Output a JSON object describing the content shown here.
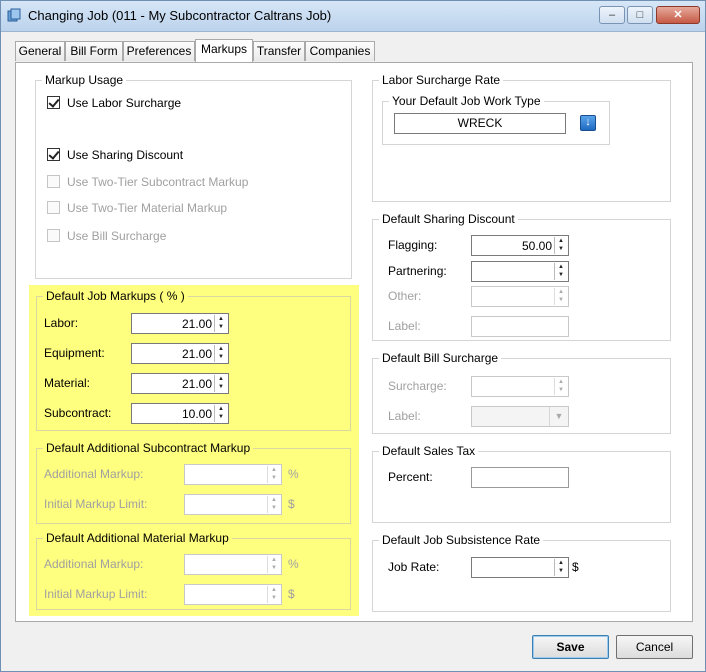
{
  "window": {
    "title": "Changing Job  (011 - My Subcontractor Caltrans Job)",
    "minimize_glyph": "–",
    "maximize_glyph": "□",
    "close_glyph": "✕"
  },
  "tabs": [
    {
      "label": "General"
    },
    {
      "label": "Bill Form"
    },
    {
      "label": "Preferences"
    },
    {
      "label": "Markups"
    },
    {
      "label": "Transfer"
    },
    {
      "label": "Companies"
    }
  ],
  "markup_usage": {
    "title": "Markup Usage",
    "use_labor_surcharge": "Use Labor Surcharge",
    "use_sharing_discount": "Use Sharing Discount",
    "use_two_tier_subcontract": "Use Two-Tier Subcontract Markup",
    "use_two_tier_material": "Use Two-Tier Material Markup",
    "use_bill_surcharge": "Use Bill Surcharge"
  },
  "default_job_markups": {
    "title": "Default Job Markups ( % )",
    "labor_label": "Labor:",
    "labor_value": "21.00",
    "equipment_label": "Equipment:",
    "equipment_value": "21.00",
    "material_label": "Material:",
    "material_value": "21.00",
    "subcontract_label": "Subcontract:",
    "subcontract_value": "10.00"
  },
  "additional_subcontract": {
    "title": "Default Additional Subcontract Markup",
    "additional_label": "Additional Markup:",
    "additional_unit": "%",
    "limit_label": "Initial Markup Limit:",
    "limit_unit": "$"
  },
  "additional_material": {
    "title": "Default Additional Material Markup",
    "additional_label": "Additional Markup:",
    "additional_unit": "%",
    "limit_label": "Initial Markup Limit:",
    "limit_unit": "$"
  },
  "labor_surcharge_rate": {
    "title": "Labor Surcharge Rate",
    "work_type_title": "Your Default Job Work Type",
    "work_type_value": "WRECK"
  },
  "sharing_discount": {
    "title": "Default Sharing Discount",
    "flagging_label": "Flagging:",
    "flagging_value": "50.00",
    "partnering_label": "Partnering:",
    "other_label": "Other:",
    "label_label": "Label:"
  },
  "bill_surcharge": {
    "title": "Default Bill Surcharge",
    "surcharge_label": "Surcharge:",
    "label_label": "Label:"
  },
  "sales_tax": {
    "title": "Default Sales Tax",
    "percent_label": "Percent:"
  },
  "subsistence": {
    "title": "Default Job Subsistence Rate",
    "job_rate_label": "Job Rate:",
    "unit": "$"
  },
  "buttons": {
    "save": "Save",
    "cancel": "Cancel"
  },
  "colors": {
    "highlight": "#ffff7f",
    "title_bar": "#c8dcf0"
  }
}
